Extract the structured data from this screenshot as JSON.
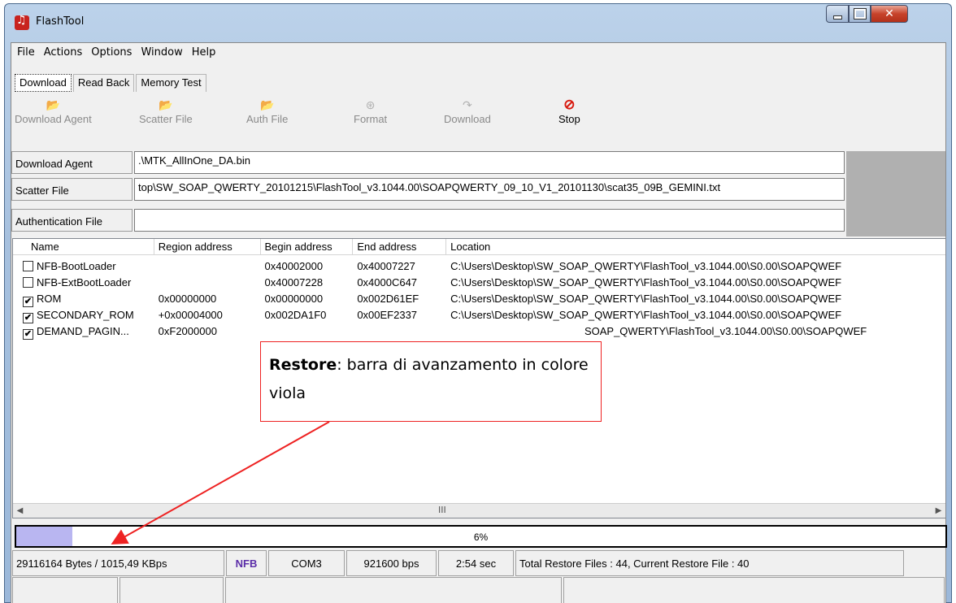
{
  "window": {
    "title": "FlashTool"
  },
  "menu": [
    "File",
    "Actions",
    "Options",
    "Window",
    "Help"
  ],
  "tabs": [
    "Download",
    "Read Back",
    "Memory Test"
  ],
  "toolbar": {
    "download_agent": "Download Agent",
    "scatter_file": "Scatter File",
    "auth_file": "Auth File",
    "format": "Format",
    "download": "Download",
    "stop": "Stop"
  },
  "fields": {
    "download_agent": {
      "label": "Download Agent",
      "value": ".\\MTK_AllInOne_DA.bin"
    },
    "scatter_file": {
      "label": "Scatter File",
      "value": "top\\SW_SOAP_QWERTY_20101215\\FlashTool_v3.1044.00\\SOAPQWERTY_09_10_V1_20101130\\scat35_09B_GEMINI.txt"
    },
    "auth_file": {
      "label": "Authentication File",
      "value": ""
    }
  },
  "list": {
    "columns": [
      "Name",
      "Region address",
      "Begin address",
      "End address",
      "Location"
    ],
    "rows": [
      {
        "checked": false,
        "name": "NFB-BootLoader",
        "region": "",
        "begin": "0x40002000",
        "end": "0x40007227",
        "location": "C:\\Users\\Desktop\\SW_SOAP_QWERTY\\FlashTool_v3.1044.00\\S0.00\\SOAPQWEF"
      },
      {
        "checked": false,
        "name": "NFB-ExtBootLoader",
        "region": "",
        "begin": "0x40007228",
        "end": "0x4000C647",
        "location": "C:\\Users\\Desktop\\SW_SOAP_QWERTY\\FlashTool_v3.1044.00\\S0.00\\SOAPQWEF"
      },
      {
        "checked": true,
        "name": "ROM",
        "region": "0x00000000",
        "begin": "0x00000000",
        "end": "0x002D61EF",
        "location": "C:\\Users\\Desktop\\SW_SOAP_QWERTY\\FlashTool_v3.1044.00\\S0.00\\SOAPQWEF"
      },
      {
        "checked": true,
        "name": "SECONDARY_ROM",
        "region": "+0x00004000",
        "begin": "0x002DA1F0",
        "end": "0x00EF2337",
        "location": "C:\\Users\\Desktop\\SW_SOAP_QWERTY\\FlashTool_v3.1044.00\\S0.00\\SOAPQWEF"
      },
      {
        "checked": true,
        "name": "DEMAND_PAGIN...",
        "region": "0xF2000000",
        "begin": "",
        "end": "",
        "location": "SOAP_QWERTY\\FlashTool_v3.1044.00\\S0.00\\SOAPQWEF"
      }
    ],
    "scroll_grip": "III"
  },
  "progress": {
    "fraction": 0.06,
    "label": "6%",
    "color": "#b9b6f1"
  },
  "status": {
    "bytes": "29116164 Bytes / 1015,49 KBps",
    "mode": "NFB",
    "port": "COM3",
    "baud": "921600 bps",
    "time": "2:54 sec",
    "files": "Total Restore Files : 44, Current Restore File : 40"
  },
  "callout": {
    "bold": "Restore",
    "text": ": barra di avanzamento in colore viola"
  },
  "colors": {
    "accent_red": "#e22222",
    "stop_red": "#d8190e",
    "mode_text": "#5b2da8"
  }
}
